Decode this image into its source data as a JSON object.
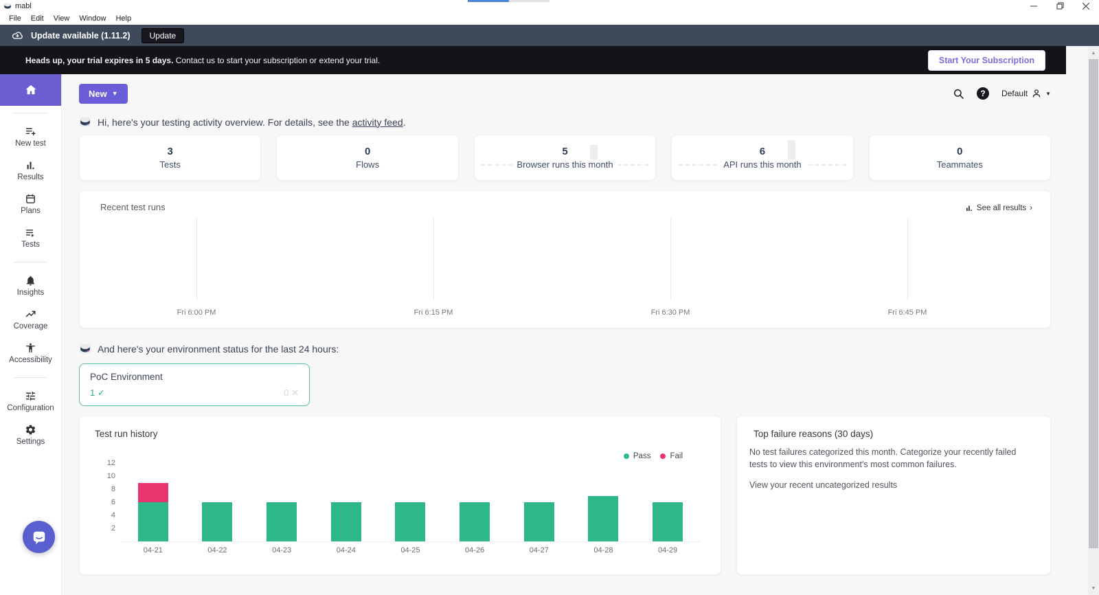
{
  "window": {
    "app_name": "mabl",
    "menu": [
      "File",
      "Edit",
      "View",
      "Window",
      "Help"
    ]
  },
  "update_banner": {
    "text": "Update available (1.11.2)",
    "button_label": "Update"
  },
  "trial_banner": {
    "bold_text": "Heads up, your trial expires in 5 days.",
    "text": " Contact us to start your subscription or extend your trial.",
    "button_label": "Start Your Subscription"
  },
  "topbar": {
    "new_button_label": "New",
    "account_label": "Default"
  },
  "sidebar": {
    "items": [
      {
        "label": "New test"
      },
      {
        "label": "Results"
      },
      {
        "label": "Plans"
      },
      {
        "label": "Tests"
      },
      {
        "label": "Insights"
      },
      {
        "label": "Coverage"
      },
      {
        "label": "Accessibility"
      },
      {
        "label": "Configuration"
      },
      {
        "label": "Settings"
      }
    ]
  },
  "greeting": {
    "text": "Hi, here's your testing activity overview. For details, see the",
    "link": "activity feed",
    "suffix": "."
  },
  "stats": [
    {
      "value": "3",
      "label": "Tests"
    },
    {
      "value": "0",
      "label": "Flows"
    },
    {
      "value": "5",
      "label": "Browser runs this month"
    },
    {
      "value": "6",
      "label": "API runs this month"
    },
    {
      "value": "0",
      "label": "Teammates"
    }
  ],
  "recent_runs": {
    "title": "Recent test runs",
    "see_all_label": "See all results",
    "chevron": "›"
  },
  "environment": {
    "heading": "And here's your environment status for the last 24 hours:",
    "card": {
      "name": "PoC Environment",
      "pass_count": "1",
      "pass_mark": "✓",
      "fail_count": "0",
      "fail_mark": "✕"
    }
  },
  "failure_panel": {
    "title": "Top failure reasons (30 days)",
    "body": "No test failures categorized this month. Categorize your recently failed tests to view this environment's most common failures.",
    "link": "View your recent uncategorized results"
  },
  "chart_data": [
    {
      "type": "line",
      "title": "Recent test runs",
      "x_ticks": [
        "Fri 6:00 PM",
        "Fri 6:15 PM",
        "Fri 6:30 PM",
        "Fri 6:45 PM"
      ],
      "series": [],
      "grid": true,
      "legend_position": "none"
    },
    {
      "type": "bar",
      "stacked": true,
      "title": "Test run history",
      "categories": [
        "04-21",
        "04-22",
        "04-23",
        "04-24",
        "04-25",
        "04-26",
        "04-27",
        "04-28",
        "04-29"
      ],
      "series": [
        {
          "name": "Pass",
          "color": "#2eb88a",
          "values": [
            6,
            6,
            6,
            6,
            6,
            6,
            6,
            7,
            6
          ]
        },
        {
          "name": "Fail",
          "color": "#e8356d",
          "values": [
            3,
            0,
            0,
            0,
            0,
            0,
            0,
            0,
            0
          ]
        }
      ],
      "ylim": [
        0,
        12
      ],
      "yticks": [
        2,
        4,
        6,
        8,
        10,
        12
      ],
      "xlabel": "",
      "ylabel": "",
      "grid": false,
      "legend_position": "top-right"
    }
  ],
  "colors": {
    "brand_purple": "#6a5ed8",
    "pass_green": "#2eb88a",
    "fail_red": "#e8356d",
    "update_banner_bg": "#3e4a5b",
    "trial_banner_bg": "#131318",
    "env_border_green": "#57c19a"
  }
}
